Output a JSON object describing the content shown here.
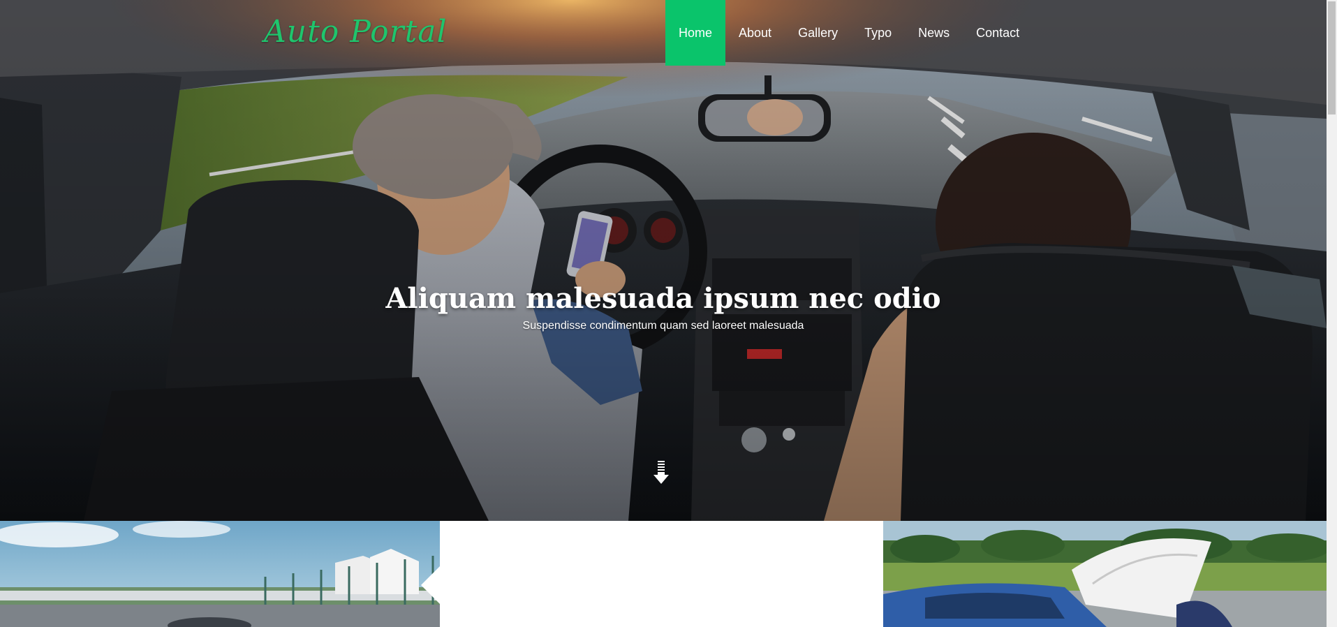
{
  "header": {
    "logo_text": "Auto Portal",
    "nav": [
      {
        "label": "Home",
        "active": true
      },
      {
        "label": "About",
        "active": false
      },
      {
        "label": "Gallery",
        "active": false
      },
      {
        "label": "Typo",
        "active": false
      },
      {
        "label": "News",
        "active": false
      },
      {
        "label": "Contact",
        "active": false
      }
    ]
  },
  "hero": {
    "title": "Aliquam malesuada ipsum nec odio",
    "subtitle": "Suspendisse condimentum quam sed laoreet malesuada",
    "scroll_icon": "arrow-down-icon",
    "image_subject": "two people driving in a car"
  },
  "colors": {
    "accent": "#0ac46b",
    "logo": "#1fc56d",
    "text_light": "#ffffff"
  }
}
